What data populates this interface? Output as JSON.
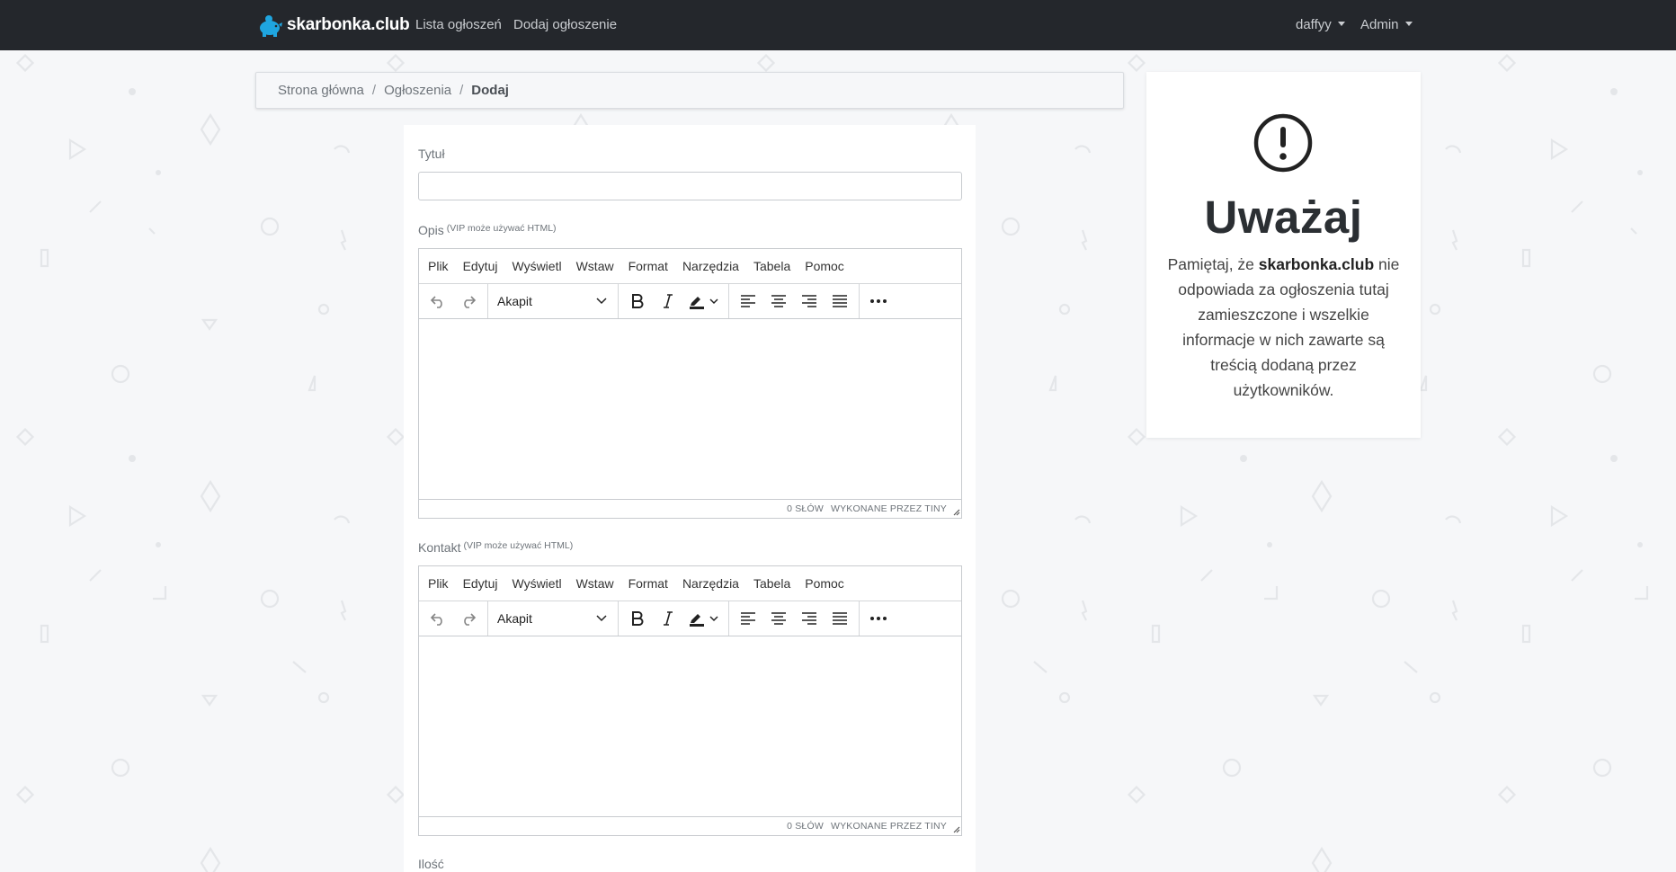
{
  "navbar": {
    "brand": "skarbonka.club",
    "links": [
      {
        "label": "Lista ogłoszeń"
      },
      {
        "label": "Dodaj ogłoszenie"
      }
    ],
    "user_menu": "daffyy",
    "admin_menu": "Admin",
    "background": "#24272c"
  },
  "breadcrumb": {
    "items": [
      "Strona główna",
      "Ogłoszenia"
    ],
    "active": "Dodaj"
  },
  "form": {
    "title_label": "Tytuł",
    "title_value": "",
    "description_label": "Opis",
    "description_note": "(VIP może używać HTML)",
    "contact_label": "Kontakt",
    "contact_note": "(VIP może używać HTML)",
    "quantity_label": "Ilość"
  },
  "editor": {
    "menu": [
      "Plik",
      "Edytuj",
      "Wyświetl",
      "Wstaw",
      "Format",
      "Narzędzia",
      "Tabela",
      "Pomoc"
    ],
    "block_format": "Akapit",
    "word_count": "0 SŁÓW",
    "powered_by": "WYKONANE PRZEZ TINY",
    "toolbar_icons": [
      "undo-icon",
      "redo-icon",
      "bold-icon",
      "italic-icon",
      "highlight-color-icon",
      "align-left-icon",
      "align-center-icon",
      "align-right-icon",
      "align-justify-icon",
      "more-icon"
    ]
  },
  "warning": {
    "title": "Uważaj",
    "text_before": "Pamiętaj, że ",
    "text_brand": "skarbonka.club",
    "text_after": " nie odpowiada za ogłoszenia tutaj zamieszczone i wszelkie informacje w nich zawarte są treścią dodaną przez użytkowników.",
    "icon": "exclamation-circle-icon"
  },
  "colors": {
    "page_background": "#f6f7f9",
    "brand_logo": "#1fa5df"
  }
}
